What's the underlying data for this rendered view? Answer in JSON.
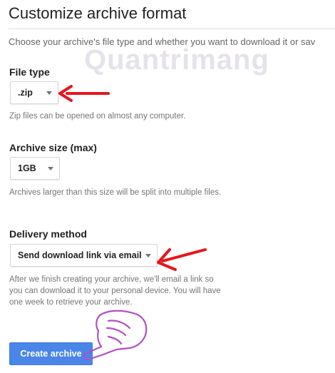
{
  "header": {
    "title": "Customize archive format",
    "intro": "Choose your archive's file type and whether you want to download it or sav"
  },
  "watermark": {
    "text": "Quantrimang"
  },
  "file_type": {
    "label": "File type",
    "selected": ".zip",
    "description": "Zip files can be opened on almost any computer."
  },
  "archive_size": {
    "label": "Archive size (max)",
    "selected": "1GB",
    "description": "Archives larger than this size will be split into multiple files."
  },
  "delivery": {
    "label": "Delivery method",
    "selected": "Send download link via email",
    "description": "After we finish creating your archive, we'll email a link so you can download it to your personal device. You will have one week to retrieve your archive."
  },
  "actions": {
    "create_label": "Create archive"
  },
  "colors": {
    "accent": "#4a86e8",
    "annotation": "#e8151e",
    "hand": "#b14fc5"
  }
}
